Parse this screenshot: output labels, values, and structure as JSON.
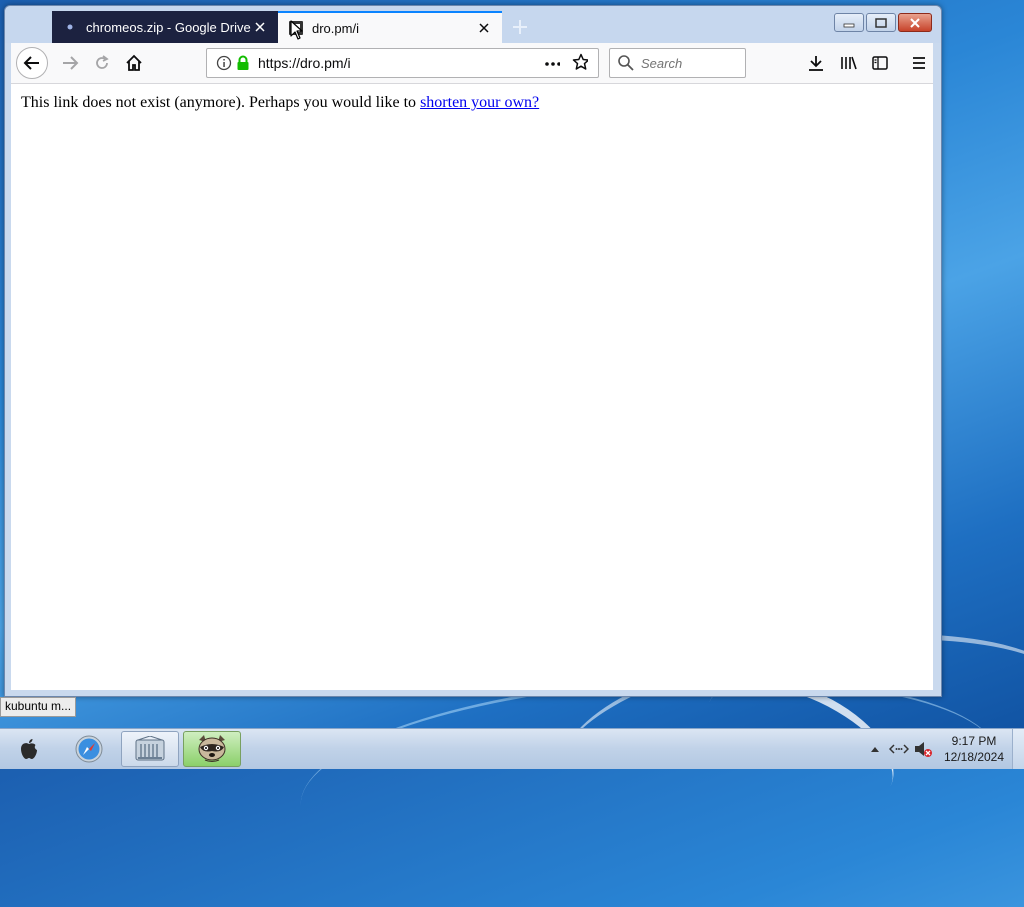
{
  "browser": {
    "tabs": [
      {
        "title": "chromeos.zip - Google Drive",
        "active": false
      },
      {
        "title": "dro.pm/i",
        "active": true
      }
    ],
    "url": "https://dro.pm/i",
    "search_placeholder": "Search"
  },
  "page": {
    "message_text": "This link does not exist (anymore). Perhaps you would like to ",
    "link_text": "shorten your own?"
  },
  "status_tooltip": "kubuntu m...",
  "taskbar": {
    "apps": [
      "apple-logo",
      "safari",
      "finder",
      "raccoon-app"
    ],
    "clock_time": "9:17 PM",
    "clock_date": "12/18/2024"
  },
  "colors": {
    "accent": "#0a84ff",
    "secure_lock": "#12bc00",
    "link": "#0000ee",
    "inactive_tab": "#1c2240"
  }
}
